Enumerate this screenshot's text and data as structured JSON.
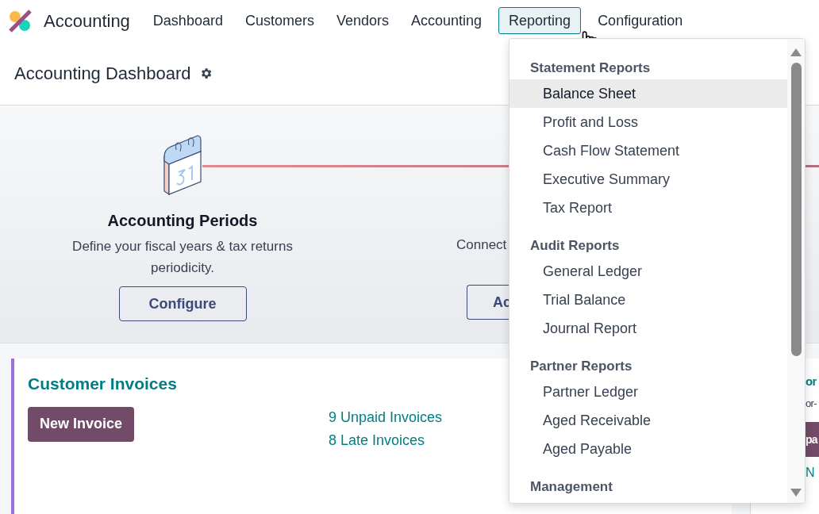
{
  "app": {
    "name": "Accounting"
  },
  "nav": [
    {
      "label": "Dashboard",
      "selected": false
    },
    {
      "label": "Customers",
      "selected": false
    },
    {
      "label": "Vendors",
      "selected": false
    },
    {
      "label": "Accounting",
      "selected": false
    },
    {
      "label": "Reporting",
      "selected": true
    },
    {
      "label": "Configuration",
      "selected": false
    }
  ],
  "page_title": "Accounting Dashboard",
  "onboarding": [
    {
      "title": "Accounting Periods",
      "description": "Define your fiscal years & tax returns periodicity.",
      "button": "Configure"
    },
    {
      "description": "Connect",
      "button": "Ac"
    }
  ],
  "dropdown": {
    "sections": [
      {
        "title": "Statement Reports",
        "items": [
          {
            "label": "Balance Sheet",
            "selected": true
          },
          {
            "label": "Profit and Loss",
            "selected": false
          },
          {
            "label": "Cash Flow Statement",
            "selected": false
          },
          {
            "label": "Executive Summary",
            "selected": false
          },
          {
            "label": "Tax Report",
            "selected": false
          }
        ]
      },
      {
        "title": "Audit Reports",
        "items": [
          {
            "label": "General Ledger",
            "selected": false
          },
          {
            "label": "Trial Balance",
            "selected": false
          },
          {
            "label": "Journal Report",
            "selected": false
          }
        ]
      },
      {
        "title": "Partner Reports",
        "items": [
          {
            "label": "Partner Ledger",
            "selected": false
          },
          {
            "label": "Aged Receivable",
            "selected": false
          },
          {
            "label": "Aged Payable",
            "selected": false
          }
        ]
      },
      {
        "title": "Management"
      }
    ]
  },
  "cards": [
    {
      "title": "Customer Invoices",
      "button": "New Invoice",
      "links": [
        "9 Unpaid Invoices",
        "8 Late Invoices"
      ]
    },
    {
      "title": "or",
      "subtitle": "or-",
      "button": "pa",
      "links": [
        "N"
      ]
    }
  ]
}
